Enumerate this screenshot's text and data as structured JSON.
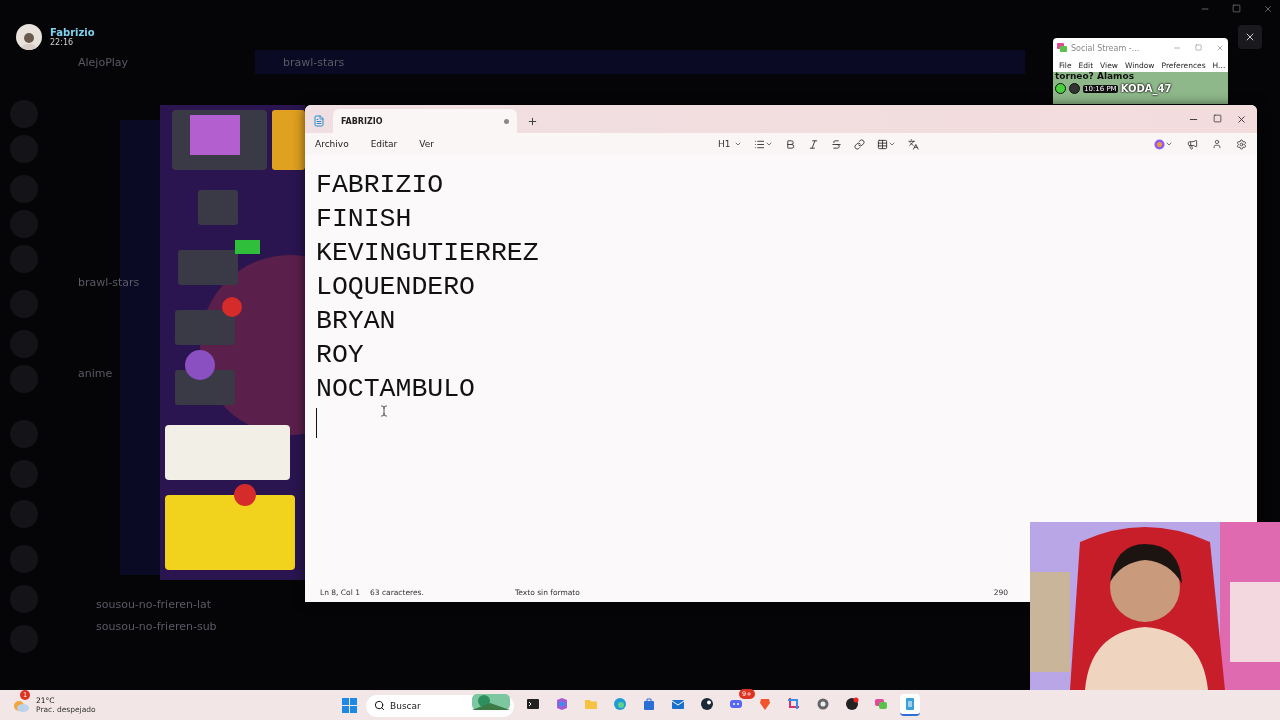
{
  "notification": {
    "name": "Fabrizio",
    "time": "22:16"
  },
  "background_app": {
    "server": "AlejoPlay",
    "channel": "brawl-stars",
    "channels": [
      "brawl-stars",
      "anime",
      "sousou-no-frieren-lat",
      "sousou-no-frieren-sub"
    ]
  },
  "social_stream": {
    "title": "Social Stream -...",
    "menu": [
      "File",
      "Edit",
      "View",
      "Window",
      "Preferences",
      "H..."
    ],
    "message": "torneo? Alamos",
    "time": "10:16 PM",
    "user": "KODA_47"
  },
  "notepad": {
    "tabs": [
      {
        "label": "FABRIZIO",
        "selected": true,
        "unsaved": true
      }
    ],
    "menu": [
      "Archivo",
      "Editar",
      "Ver"
    ],
    "heading": "H1",
    "lines": [
      "FABRIZIO",
      "FINISH",
      "KEVINGUTIERREZ",
      "LOQUENDERO",
      "BRYAN",
      "ROY",
      "NOCTAMBULO"
    ],
    "status": {
      "position": "Ln 8, Col 1",
      "count": "63 caracteres.",
      "format": "Texto sin formato",
      "zoom": "290"
    }
  },
  "taskbar": {
    "weather": {
      "temp": "21°C",
      "desc": "Prac. despejado",
      "badge": "1"
    },
    "search": {
      "placeholder": "Buscar"
    },
    "apps": [
      {
        "kind": "terminal",
        "selected": false
      },
      {
        "kind": "m365",
        "selected": false
      },
      {
        "kind": "folder",
        "selected": false
      },
      {
        "kind": "edge",
        "selected": false
      },
      {
        "kind": "store",
        "selected": false
      },
      {
        "kind": "outlook",
        "selected": false
      },
      {
        "kind": "steam",
        "selected": false
      },
      {
        "kind": "discord",
        "selected": false,
        "badge": "9+"
      },
      {
        "kind": "brave",
        "selected": false
      },
      {
        "kind": "snip",
        "selected": false
      },
      {
        "kind": "settings",
        "selected": false
      },
      {
        "kind": "obs",
        "selected": false
      },
      {
        "kind": "chat",
        "selected": false
      },
      {
        "kind": "notepad",
        "selected": true
      }
    ]
  }
}
